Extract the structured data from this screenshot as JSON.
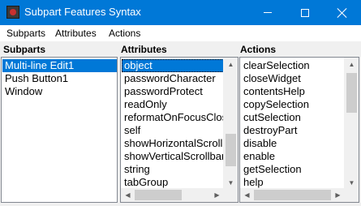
{
  "window": {
    "title": "Subpart Features Syntax",
    "icon": "app-icon",
    "accent": "#0078d7"
  },
  "menubar": {
    "items": [
      "Subparts",
      "Attributes",
      "Actions"
    ]
  },
  "columns": {
    "subparts_header": "Subparts",
    "attributes_header": "Attributes",
    "actions_header": "Actions"
  },
  "subparts": {
    "items": [
      "Multi-line Edit1",
      "Push Button1",
      "Window"
    ],
    "selected_index": 0
  },
  "attributes": {
    "items": [
      "object",
      "passwordCharacter",
      "passwordProtect",
      "readOnly",
      "reformatOnFocusClose",
      "self",
      "showHorizontalScrollbar",
      "showVerticalScrollbar",
      "string",
      "tabGroup"
    ],
    "selected_index": 0
  },
  "actions": {
    "items": [
      "clearSelection",
      "closeWidget",
      "contentsHelp",
      "copySelection",
      "cutSelection",
      "destroyPart",
      "disable",
      "enable",
      "getSelection",
      "help"
    ]
  }
}
